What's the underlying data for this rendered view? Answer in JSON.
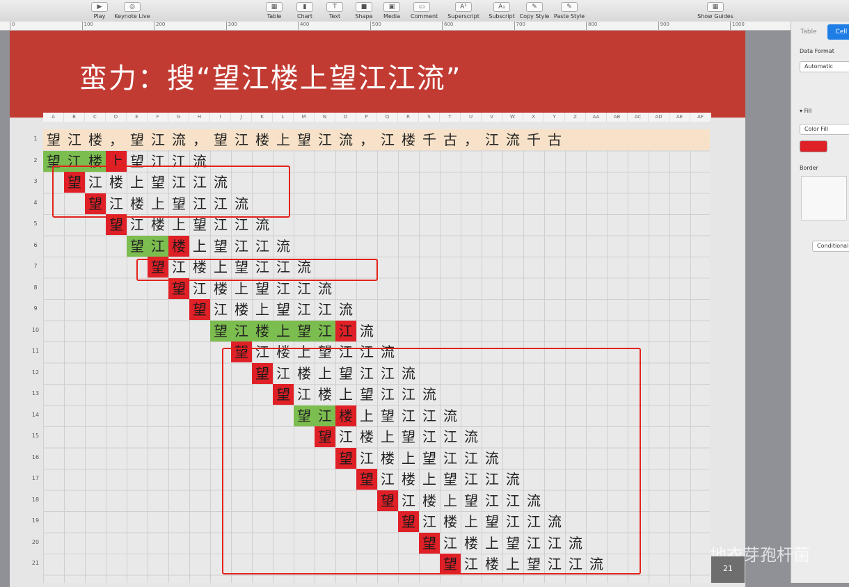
{
  "toolbar": {
    "items": [
      {
        "label": "Play",
        "icon": "play-icon",
        "glyph": "▶"
      },
      {
        "label": "Keynote Live",
        "icon": "keynote-live-icon",
        "glyph": "◎"
      },
      {
        "label": "Table",
        "icon": "table-icon",
        "glyph": "▦"
      },
      {
        "label": "Chart",
        "icon": "chart-icon",
        "glyph": "▮"
      },
      {
        "label": "Text",
        "icon": "text-icon",
        "glyph": "T"
      },
      {
        "label": "Shape",
        "icon": "shape-icon",
        "glyph": "■"
      },
      {
        "label": "Media",
        "icon": "media-icon",
        "glyph": "▣"
      },
      {
        "label": "Comment",
        "icon": "comment-icon",
        "glyph": "▭"
      },
      {
        "label": "Superscript",
        "icon": "superscript-icon",
        "glyph": "A¹"
      },
      {
        "label": "Subscript",
        "icon": "subscript-icon",
        "glyph": "A₁"
      },
      {
        "label": "Copy Style",
        "icon": "copy-style-icon",
        "glyph": "✎"
      },
      {
        "label": "Paste Style",
        "icon": "paste-style-icon",
        "glyph": "✎"
      },
      {
        "label": "Show Guides",
        "icon": "guides-icon",
        "glyph": "▦"
      }
    ]
  },
  "ruler": {
    "ticks": [
      "0",
      "100",
      "200",
      "300",
      "400",
      "500",
      "600",
      "700",
      "800",
      "900",
      "1000"
    ]
  },
  "slide": {
    "title": "蛮力：搜“望江楼上望江江流”",
    "watermark": "地衣芽孢杆菌",
    "page_number": "21"
  },
  "sheet": {
    "columns": [
      "A",
      "B",
      "C",
      "D",
      "E",
      "F",
      "G",
      "H",
      "I",
      "J",
      "K",
      "L",
      "M",
      "N",
      "O",
      "P",
      "Q",
      "R",
      "S",
      "T",
      "U",
      "V",
      "W",
      "X",
      "Y",
      "Z",
      "AA",
      "AB",
      "AC",
      "AD",
      "AE",
      "AF"
    ],
    "rows": [
      "1",
      "2",
      "3",
      "4",
      "5",
      "6",
      "7",
      "8",
      "9",
      "10",
      "11",
      "12",
      "13",
      "14",
      "15",
      "16",
      "17",
      "18",
      "19",
      "20",
      "21"
    ],
    "text_row": "望江楼，望江流，望江楼上望江流，江楼千古，江流千古",
    "pattern": "望江楼上望江江流",
    "attempts": [
      {
        "offset": 0,
        "matched": 3
      },
      {
        "offset": 1,
        "matched": 0
      },
      {
        "offset": 2,
        "matched": 0
      },
      {
        "offset": 3,
        "matched": 0
      },
      {
        "offset": 4,
        "matched": 2
      },
      {
        "offset": 5,
        "matched": 0
      },
      {
        "offset": 6,
        "matched": 0
      },
      {
        "offset": 7,
        "matched": 0
      },
      {
        "offset": 8,
        "matched": 6
      },
      {
        "offset": 9,
        "matched": 0
      },
      {
        "offset": 10,
        "matched": 0
      },
      {
        "offset": 11,
        "matched": 0
      },
      {
        "offset": 12,
        "matched": 2
      },
      {
        "offset": 13,
        "matched": 0
      },
      {
        "offset": 14,
        "matched": 0
      },
      {
        "offset": 15,
        "matched": 0
      },
      {
        "offset": 16,
        "matched": 0
      },
      {
        "offset": 17,
        "matched": 0
      },
      {
        "offset": 18,
        "matched": 0
      },
      {
        "offset": 19,
        "matched": 0
      }
    ]
  },
  "inspector": {
    "tabs": [
      "Table",
      "Cell"
    ],
    "data_format_label": "Data Format",
    "data_format_value": "Automatic",
    "fill_label": "Fill",
    "fill_value": "Color Fill",
    "fill_color": "#e02027",
    "border_label": "Border",
    "conditional_label": "Conditional Highlighting..."
  },
  "colors": {
    "banner": "#c23b33",
    "match": "#7cbd4f",
    "mismatch": "#e02027",
    "text_row": "#f7e2c9",
    "highlight_box": "#e3221b"
  }
}
